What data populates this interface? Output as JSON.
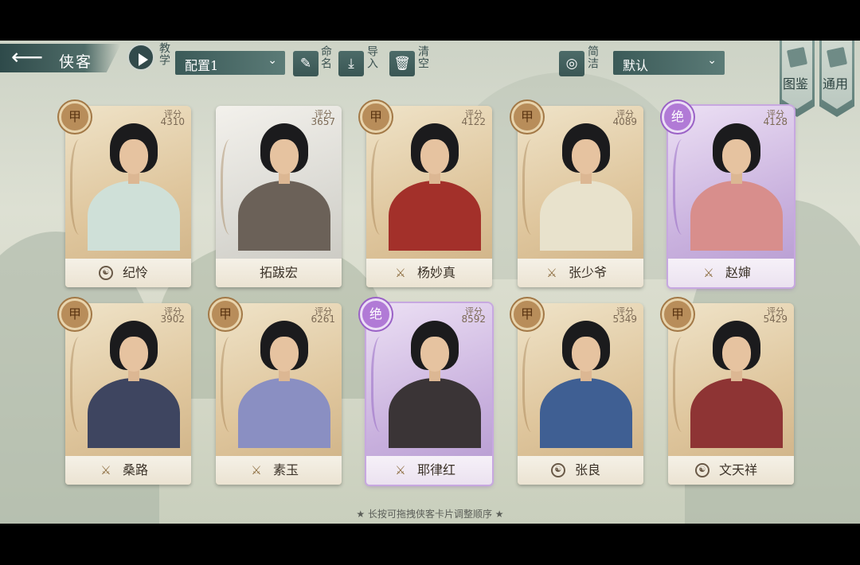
{
  "header": {
    "back_icon": "arrow-left-icon",
    "title": "侠客",
    "tutorial_label": "教学",
    "config_select": "配置1",
    "rename_label": "命名",
    "import_label": "导入",
    "clear_label": "清空",
    "simple_label": "简洁",
    "sort_select": "默认",
    "codex_label": "图鉴",
    "general_label": "通用"
  },
  "score_label": "评分",
  "cards": [
    {
      "name": "纪怜",
      "score": "4310",
      "rank": "甲",
      "frame": "gold",
      "weapon_icon": "taiji-icon"
    },
    {
      "name": "拓跋宏",
      "score": "3657",
      "rank": "",
      "frame": "grey",
      "weapon_icon": ""
    },
    {
      "name": "杨妙真",
      "score": "4122",
      "rank": "甲",
      "frame": "gold",
      "weapon_icon": "spear-icon"
    },
    {
      "name": "张少爷",
      "score": "4089",
      "rank": "甲",
      "frame": "gold",
      "weapon_icon": "spear-icon"
    },
    {
      "name": "赵婶",
      "score": "4128",
      "rank": "绝",
      "frame": "purple",
      "weapon_icon": "spear-icon"
    },
    {
      "name": "桑路",
      "score": "3902",
      "rank": "甲",
      "frame": "gold",
      "weapon_icon": "spear-icon"
    },
    {
      "name": "素玉",
      "score": "6261",
      "rank": "甲",
      "frame": "gold",
      "weapon_icon": "spear-icon"
    },
    {
      "name": "耶律红",
      "score": "8592",
      "rank": "绝",
      "frame": "purple",
      "weapon_icon": "spear-icon"
    },
    {
      "name": "张良",
      "score": "5349",
      "rank": "甲",
      "frame": "gold",
      "weapon_icon": "taiji-icon"
    },
    {
      "name": "文天祥",
      "score": "5429",
      "rank": "甲",
      "frame": "gold",
      "weapon_icon": "taiji-icon"
    }
  ],
  "footer_hint": "★ 长按可拖拽侠客卡片调整顺序 ★",
  "colors": {
    "accent": "#3b5a58",
    "gold_frame": "#dfc69d",
    "purple_frame": "#c9b1de"
  }
}
